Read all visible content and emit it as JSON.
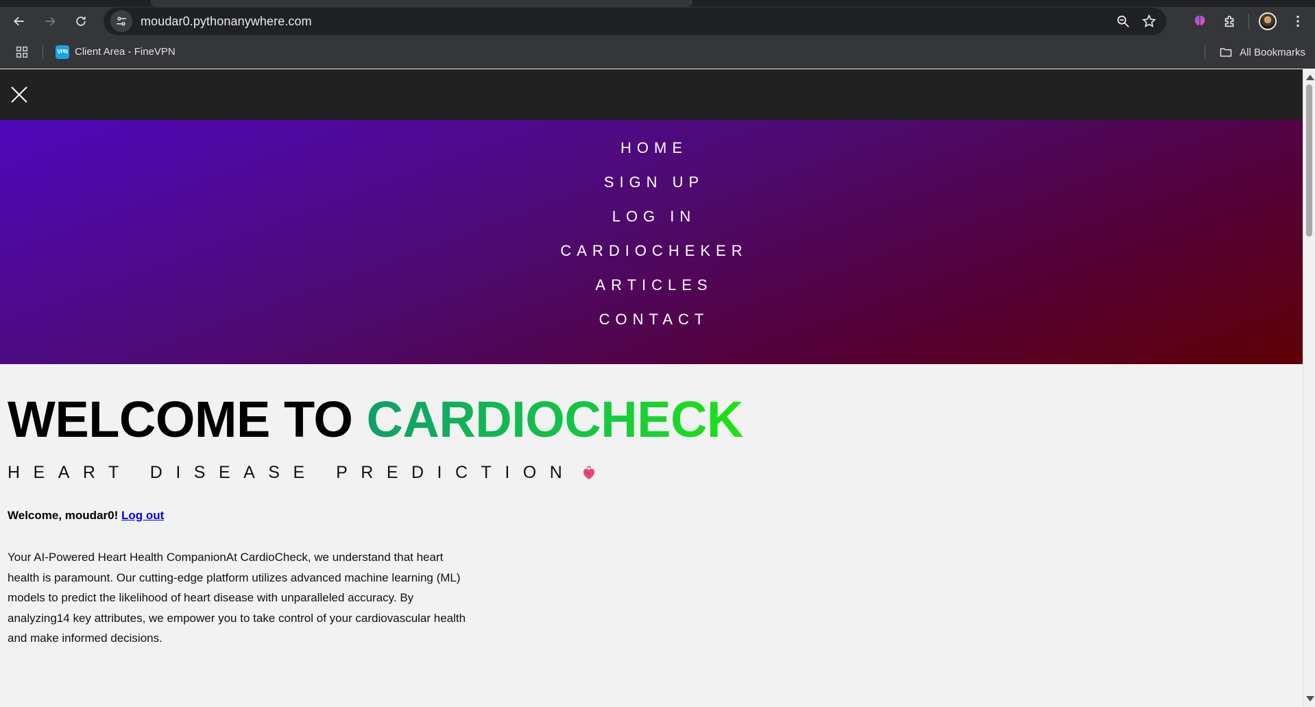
{
  "browser": {
    "url": "moudar0.pythonanywhere.com",
    "bookmarks": [
      {
        "label": "Client Area - FineVPN",
        "favicon_text": "VPN"
      }
    ],
    "all_bookmarks_label": "All Bookmarks",
    "icons": {
      "back": "arrow-left-icon",
      "forward": "arrow-right-icon",
      "reload": "reload-icon",
      "site_info": "tune-icon",
      "zoom": "zoom-icon",
      "star": "star-icon",
      "extension_brain": "brain-icon",
      "extensions": "puzzle-icon",
      "menu": "kebab-menu-icon"
    }
  },
  "site": {
    "menu_items": [
      {
        "label": "HOME"
      },
      {
        "label": "SIGN UP"
      },
      {
        "label": "LOG IN"
      },
      {
        "label": "CARDIOCHEKER"
      },
      {
        "label": "ARTICLES"
      },
      {
        "label": "CONTACT"
      }
    ],
    "hero": {
      "title_prefix": "WELCOME TO ",
      "title_brand": "CARDIOCHECK",
      "subtitle": "HEART DISEASE PREDICTION"
    },
    "greeting": {
      "text": "Welcome, moudar0!",
      "logout_label": "Log out"
    },
    "intro_text": "Your AI-Powered Heart Health CompanionAt CardioCheck, we understand that heart health is paramount. Our cutting-edge platform utilizes advanced machine learning (ML) models to predict the likelihood of heart disease with unparalleled accuracy. By analyzing14 key attributes, we empower you to take control of your cardiovascular health and make informed decisions."
  },
  "colors": {
    "menu_gradient_start": "#4f08bd",
    "menu_gradient_end": "#5e0004",
    "brand_green": "#15c742",
    "topbar": "#212121",
    "link": "#0000ee"
  }
}
